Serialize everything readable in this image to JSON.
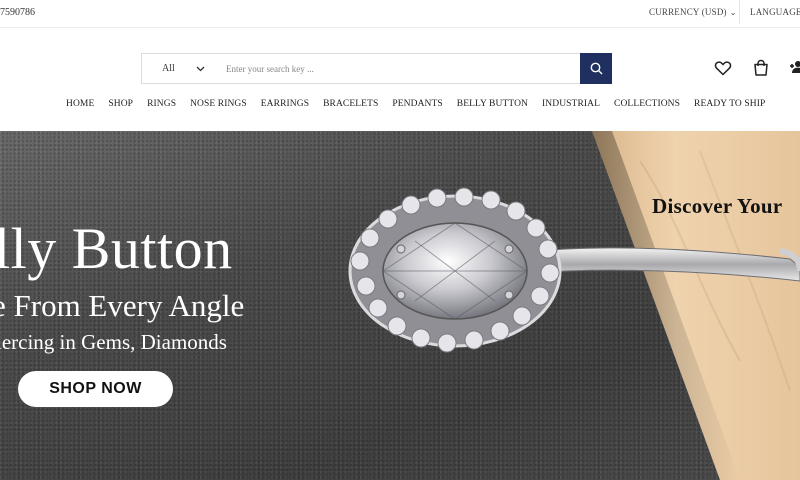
{
  "topbar": {
    "phone": "7590786",
    "currency_label": "CURRENCY (USD)",
    "language_label": "LANGUAGE"
  },
  "search": {
    "category": "All",
    "placeholder": "Enter your search key ..."
  },
  "header_icons": [
    "heart-icon",
    "shopping-bag-icon",
    "user-add-icon"
  ],
  "nav": {
    "items": [
      "HOME",
      "SHOP",
      "RINGS",
      "NOSE RINGS",
      "EARRINGS",
      "BRACELETS",
      "PENDANTS",
      "BELLY BUTTON",
      "INDUSTRIAL",
      "COLLECTIONS",
      "READY TO SHIP"
    ]
  },
  "hero": {
    "title": "lly Button",
    "subtitle": "e From Every Angle",
    "tagline": "iercing in Gems, Diamonds",
    "cta": "SHOP NOW",
    "discover": "Discover Your"
  },
  "colors": {
    "search_button": "#1f2f5f",
    "hero_cloth": "#4a4a4a",
    "hero_wood": "#e9c9a2",
    "hero_text": "#ffffff"
  }
}
